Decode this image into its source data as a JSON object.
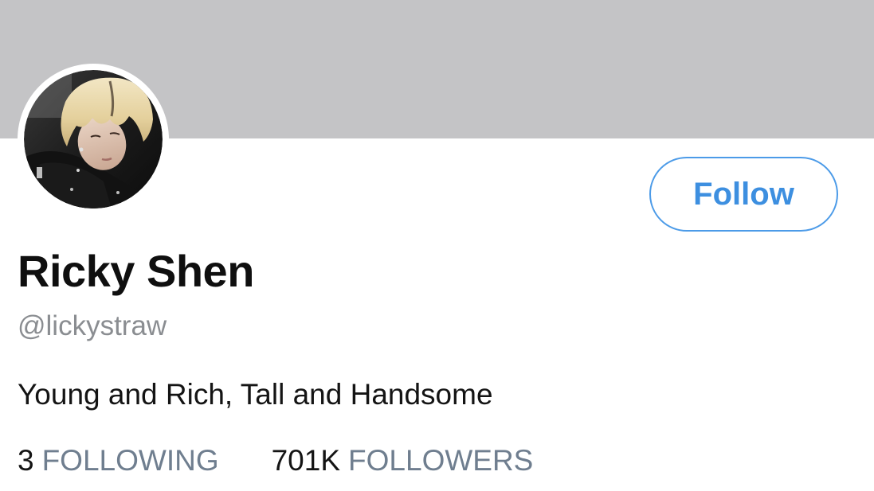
{
  "profile": {
    "name": "Ricky Shen",
    "handle": "@lickystraw",
    "bio": "Young and Rich, Tall and Handsome",
    "follow_label": "Follow",
    "stats": {
      "following_count": "3",
      "following_label": "FOLLOWING",
      "followers_count": "701K",
      "followers_label": "FOLLOWERS"
    }
  },
  "colors": {
    "banner": "#c4c4c6",
    "accent": "#4c9be8",
    "stat_label": "#6f7e8f",
    "handle": "#8a8d91"
  },
  "icons": {
    "avatar": "profile-photo"
  }
}
